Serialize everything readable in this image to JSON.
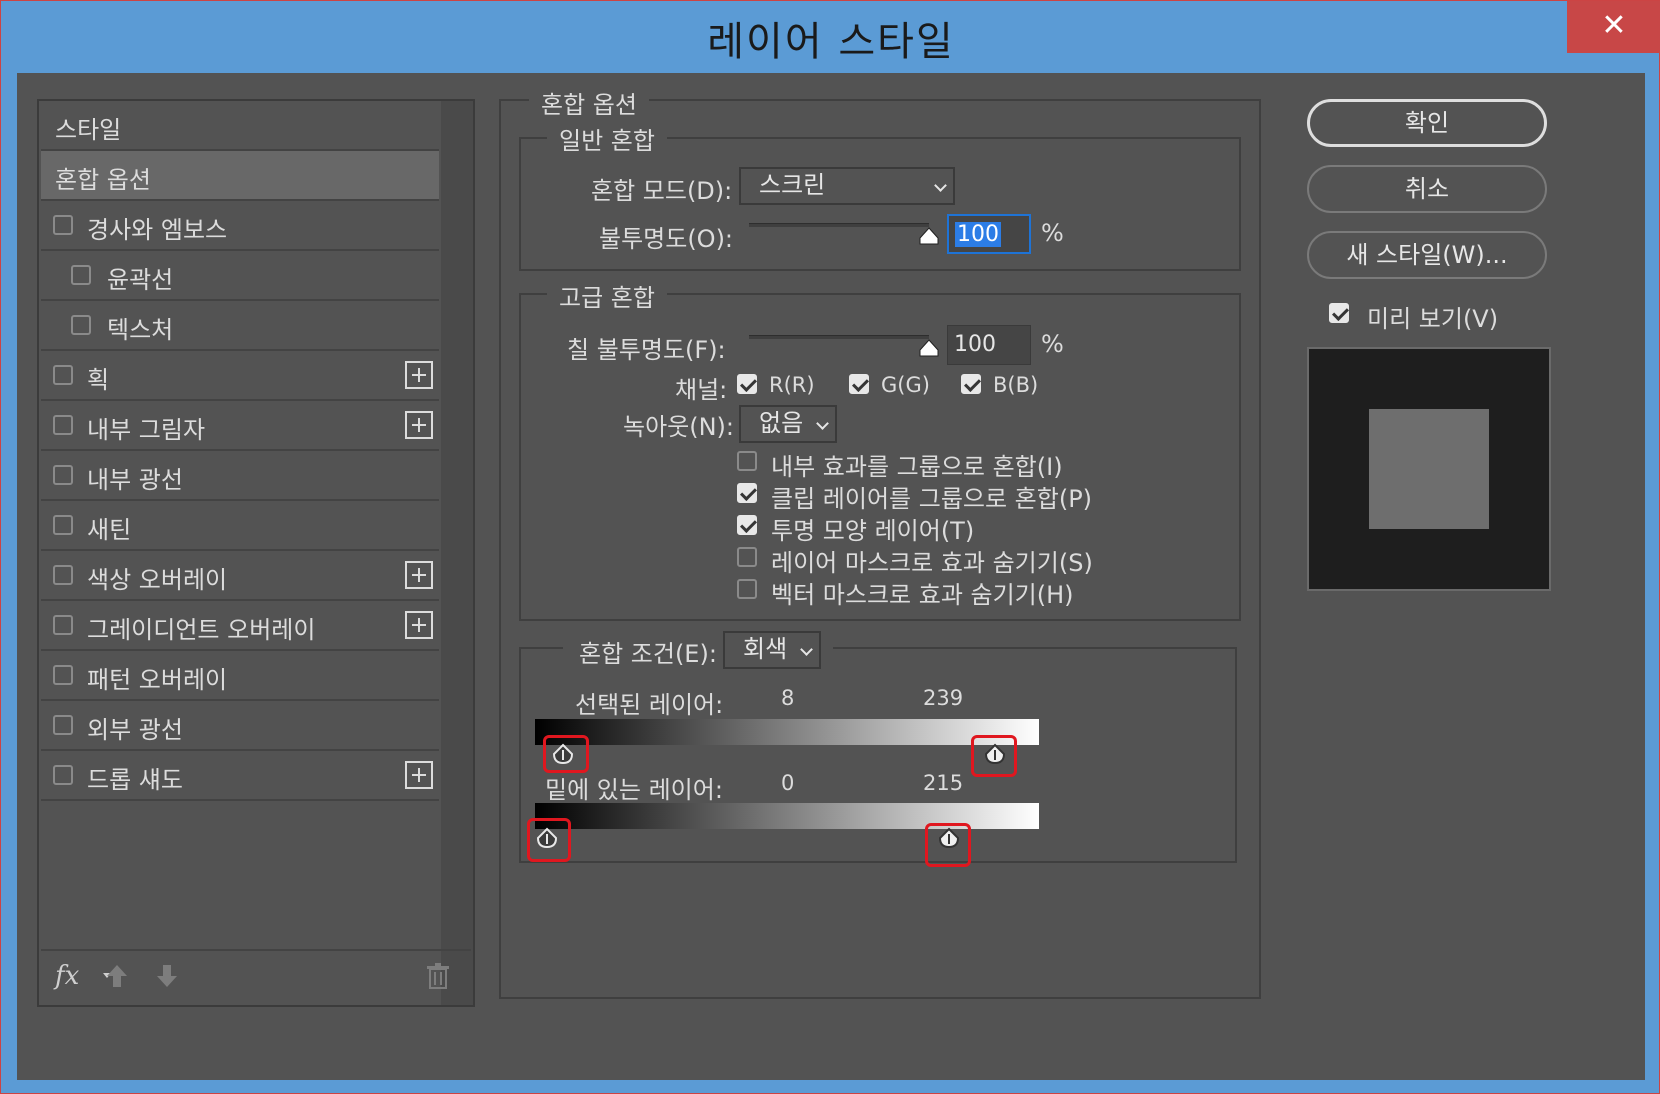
{
  "window": {
    "title": "레이어 스타일",
    "close_label": "✕"
  },
  "sidebar": {
    "header": "스타일",
    "items": [
      {
        "label": "혼합 옵션",
        "selected": true
      },
      {
        "label": "경사와 엠보스",
        "checked": false
      },
      {
        "label": "윤곽선",
        "checked": false
      },
      {
        "label": "텍스처",
        "checked": false
      },
      {
        "label": "획",
        "checked": false,
        "plus": true
      },
      {
        "label": "내부 그림자",
        "checked": false,
        "plus": true
      },
      {
        "label": "내부 광선",
        "checked": false
      },
      {
        "label": "새틴",
        "checked": false
      },
      {
        "label": "색상 오버레이",
        "checked": false,
        "plus": true
      },
      {
        "label": "그레이디언트 오버레이",
        "checked": false,
        "plus": true
      },
      {
        "label": "패턴 오버레이",
        "checked": false
      },
      {
        "label": "외부 광선",
        "checked": false
      },
      {
        "label": "드롭 섀도",
        "checked": false,
        "plus": true
      }
    ],
    "footer": {
      "fx_label": "fx"
    }
  },
  "blend_options": {
    "section_title": "혼합 옵션",
    "general": {
      "title": "일반 혼합",
      "mode_label": "혼합 모드(D):",
      "mode_value": "스크린",
      "opacity_label": "불투명도(O):",
      "opacity_value": "100",
      "opacity_unit": "%"
    },
    "advanced": {
      "title": "고급 혼합",
      "fill_label": "칠 불투명도(F):",
      "fill_value": "100",
      "fill_unit": "%",
      "channels_label": "채널:",
      "channels": [
        {
          "label": "R(R)",
          "checked": true
        },
        {
          "label": "G(G)",
          "checked": true
        },
        {
          "label": "B(B)",
          "checked": true
        }
      ],
      "knockout_label": "녹아웃(N):",
      "knockout_value": "없음",
      "options": [
        {
          "label": "내부 효과를 그룹으로 혼합(I)",
          "checked": false
        },
        {
          "label": "클립 레이어를 그룹으로 혼합(P)",
          "checked": true
        },
        {
          "label": "투명 모양 레이어(T)",
          "checked": true
        },
        {
          "label": "레이어 마스크로 효과 숨기기(S)",
          "checked": false
        },
        {
          "label": "벡터 마스크로 효과 숨기기(H)",
          "checked": false
        }
      ]
    },
    "blend_if": {
      "label": "혼합 조건(E):",
      "value": "회색",
      "this_layer_label": "선택된 레이어:",
      "this_layer_low": "8",
      "this_layer_high": "239",
      "underlying_label": "밑에 있는 레이어:",
      "underlying_low": "0",
      "underlying_high": "215"
    }
  },
  "actions": {
    "ok": "확인",
    "cancel": "취소",
    "new_style": "새 스타일(W)...",
    "preview_label": "미리 보기(V)",
    "preview_checked": true
  }
}
